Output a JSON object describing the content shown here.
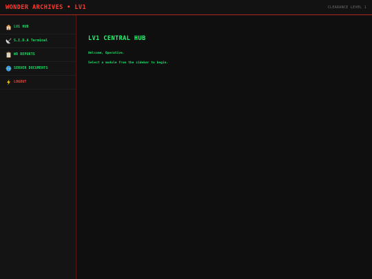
{
  "header": {
    "title": "WONDER ARCHIVES • LV1",
    "clearance": "CLEARANCE LEVEL 1"
  },
  "sidebar": {
    "items": [
      {
        "icon": "home-icon",
        "label": "LV1 HUB"
      },
      {
        "icon": "satellite-antenna-icon",
        "label": "S.I.D.A Terminal"
      },
      {
        "icon": "clipboard-icon",
        "label": "WR REPORTS"
      },
      {
        "icon": "globe-icon",
        "label": "SERVER DOCUMENTS"
      },
      {
        "icon": "lightning-icon",
        "label": "LOGOUT"
      }
    ]
  },
  "main": {
    "title": "LV1 CENTRAL HUB",
    "welcome": "Welcome, Operative.",
    "instruction": "Select a module from the sidebar to begin."
  },
  "colors": {
    "accent_red": "#ff3b30",
    "accent_green": "#1aff6e",
    "background": "#0e0e0e"
  }
}
